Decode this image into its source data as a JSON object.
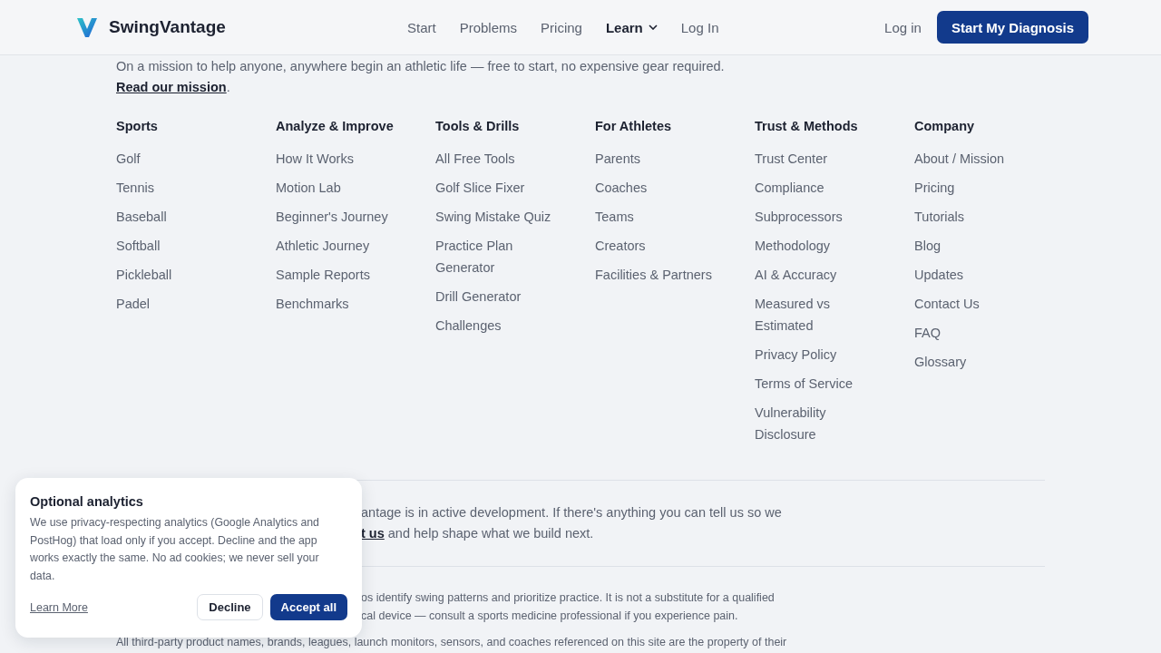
{
  "header": {
    "brand": "SwingVantage",
    "nav": [
      {
        "label": "Start",
        "selected": false,
        "kind": "link"
      },
      {
        "label": "Problems",
        "selected": false,
        "kind": "link"
      },
      {
        "label": "Pricing",
        "selected": false,
        "kind": "link"
      },
      {
        "label": "Learn",
        "selected": true,
        "kind": "menu"
      },
      {
        "label": "Log In",
        "selected": false,
        "kind": "link"
      }
    ],
    "login": "Log in",
    "cta": "Start My Diagnosis"
  },
  "mission": {
    "text": "On a mission to help anyone, anywhere begin an athletic life — free to start, no expensive gear required.",
    "link": "Read our mission",
    "end": "."
  },
  "columns": [
    {
      "heading": "Sports",
      "links": [
        "Golf",
        "Tennis",
        "Baseball",
        "Softball",
        "Pickleball",
        "Padel"
      ]
    },
    {
      "heading": "Analyze & Improve",
      "links": [
        "How It Works",
        "Motion Lab",
        "Beginner's Journey",
        "Athletic Journey",
        "Sample Reports",
        "Benchmarks"
      ]
    },
    {
      "heading": "Tools & Drills",
      "links": [
        "All Free Tools",
        "Golf Slice Fixer",
        "Swing Mistake Quiz",
        "Practice Plan Generator",
        "Drill Generator",
        "Challenges"
      ]
    },
    {
      "heading": "For Athletes",
      "links": [
        "Parents",
        "Coaches",
        "Teams",
        "Creators",
        "Facilities & Partners"
      ]
    },
    {
      "heading": "Trust & Methods",
      "links": [
        "Trust Center",
        "Compliance",
        "Subprocessors",
        "Methodology",
        "AI & Accuracy",
        "Measured vs Estimated",
        "Privacy Policy",
        "Terms of Service",
        "Vulnerability Disclosure"
      ]
    },
    {
      "heading": "Company",
      "links": [
        "About / Mission",
        "Pricing",
        "Tutorials",
        "Blog",
        "Updates",
        "Contact Us",
        "FAQ",
        "Glossary"
      ]
    }
  ],
  "feedback": {
    "line_1": "antage is in active development. If there's anything you can tell us so we",
    "link": "t us",
    "line_2": "and help shape what we build next."
  },
  "disclaimer": {
    "line_1": "os identify swing patterns and prioritize practice. It is not a substitute for a qualified",
    "line_2": "cal device — consult a sports medicine professional if you experience pain.",
    "trademarks": "All third-party product names, brands, leagues, launch monitors, sensors, and coaches referenced on this site are the property of their"
  },
  "cookie_banner": {
    "title": "Optional analytics",
    "body": "We use privacy-respecting analytics (Google Analytics and PostHog) that load only if you accept. Decline and the app works exactly the same. No ad cookies; we never sell your data.",
    "learn_more": "Learn More",
    "decline": "Decline",
    "accept": "Accept all"
  }
}
